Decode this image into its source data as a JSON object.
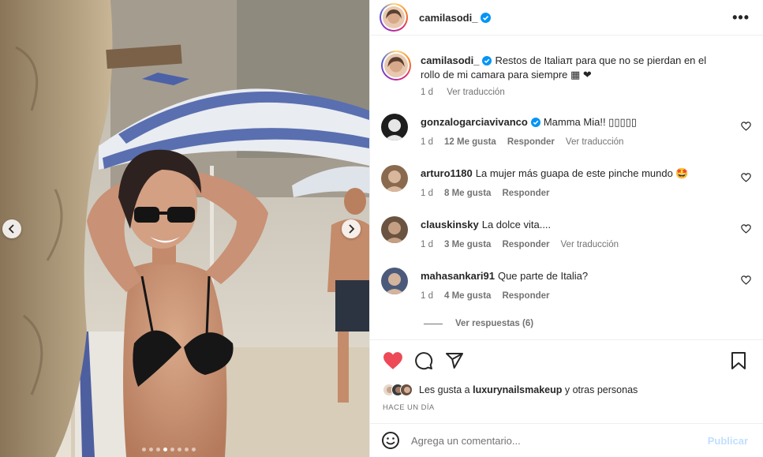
{
  "post": {
    "username": "camilasodi_",
    "more_icon": "more-horizontal-icon",
    "caption": {
      "username": "camilasodi_",
      "text": "Restos de Italiaπ para que no se pierdan en el rollo de mi camara para siempre ▦ ❤",
      "time": "1 d",
      "translate": "Ver traducción"
    },
    "comments": [
      {
        "username": "gonzalogarciavivanco",
        "verified": true,
        "text": "Mamma Mia!! ▯▯▯▯▯",
        "time": "1 d",
        "likes": "12 Me gusta",
        "reply": "Responder",
        "translate": "Ver traducción"
      },
      {
        "username": "arturo1180",
        "verified": false,
        "text": "La mujer más guapa de este pinche mundo 🤩",
        "time": "1 d",
        "likes": "8 Me gusta",
        "reply": "Responder"
      },
      {
        "username": "clauskinsky",
        "verified": false,
        "text": "La dolce vita....",
        "time": "1 d",
        "likes": "3 Me gusta",
        "reply": "Responder",
        "translate": "Ver traducción"
      },
      {
        "username": "mahasankari91",
        "verified": false,
        "text": "Que parte de Italia?",
        "time": "1 d",
        "likes": "4 Me gusta",
        "reply": "Responder"
      }
    ],
    "view_replies": "Ver respuestas (6)",
    "likes_text_prefix": "Les gusta a",
    "likes_user": "luxurynailsmakeup",
    "likes_text_suffix": "y otras personas",
    "time_ago": "HACE UN DÍA",
    "add_comment_placeholder": "Agrega un comentario...",
    "publish_label": "Publicar",
    "liked": true,
    "carousel": {
      "count": 8,
      "active_index": 3
    }
  },
  "colors": {
    "like_red": "#ed4956",
    "verified_blue": "#0095f6",
    "publish_disabled": "#c0dffd",
    "secondary_text": "#737373"
  }
}
